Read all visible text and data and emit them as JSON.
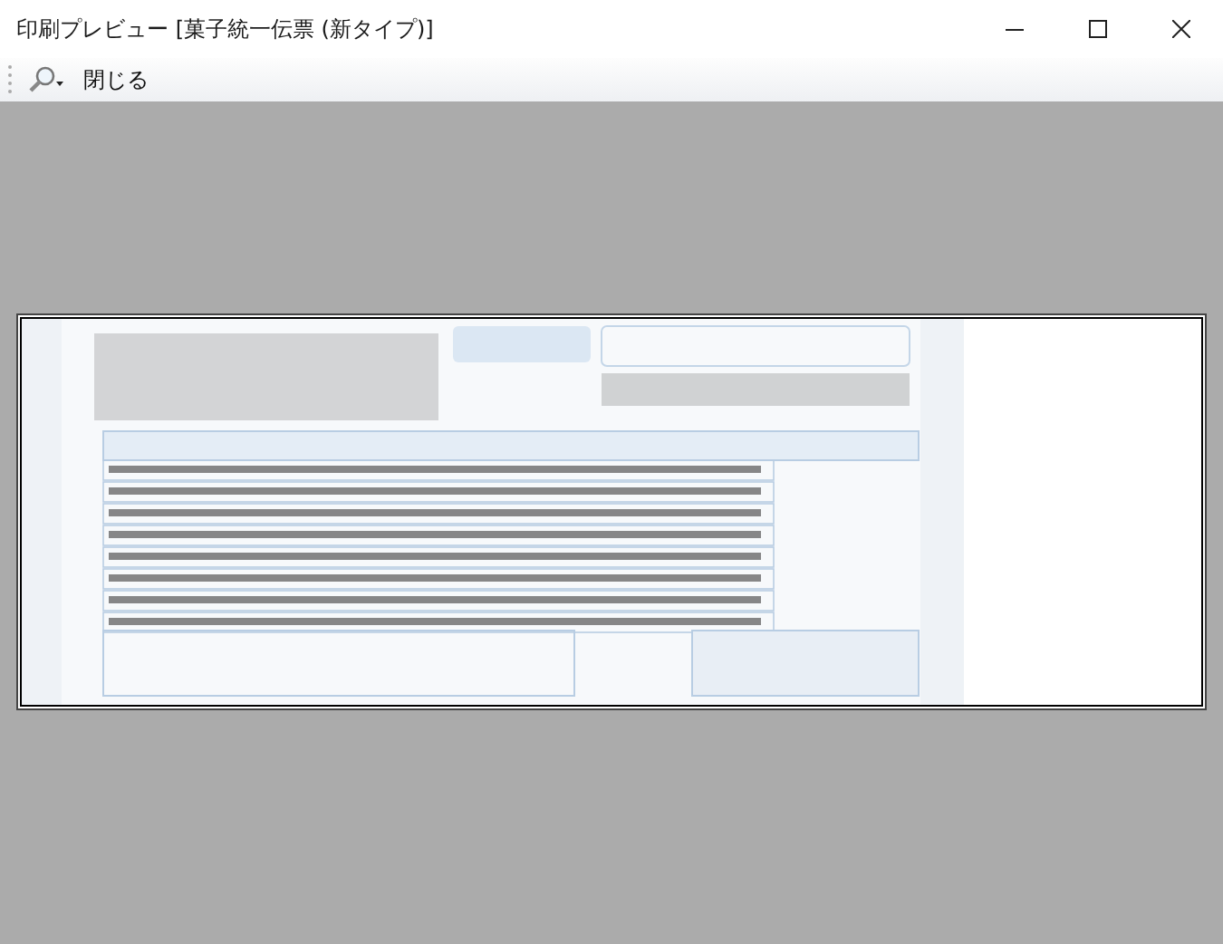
{
  "window": {
    "title": "印刷プレビュー [菓子統一伝票 (新タイプ)]"
  },
  "toolbar": {
    "buttons": [
      {
        "kind": "zoom"
      },
      {
        "kind": "text",
        "label": "閉じる"
      }
    ]
  }
}
